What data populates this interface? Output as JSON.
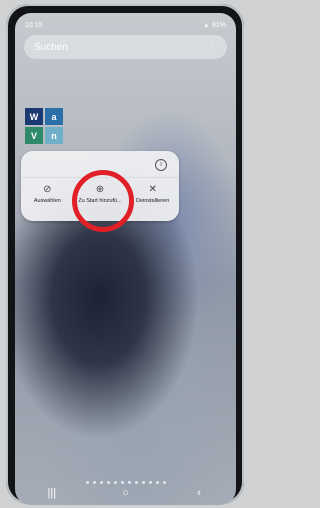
{
  "status": {
    "time": "10:15",
    "battery": "81%"
  },
  "search": {
    "placeholder": "Suchen"
  },
  "app": {
    "tiles": [
      "W",
      "a",
      "V",
      "n"
    ]
  },
  "popup": {
    "actions": [
      {
        "label": "Auswählen",
        "icon": "check-circle-icon"
      },
      {
        "label": "Zu Start hinzufü...",
        "icon": "add-to-home-icon"
      },
      {
        "label": "Deinstallieren",
        "icon": "close-icon"
      }
    ]
  },
  "colors": {
    "highlight_ring": "#e01f27"
  },
  "navbar": {
    "recents": "|||",
    "home": "○",
    "back": "‹"
  }
}
